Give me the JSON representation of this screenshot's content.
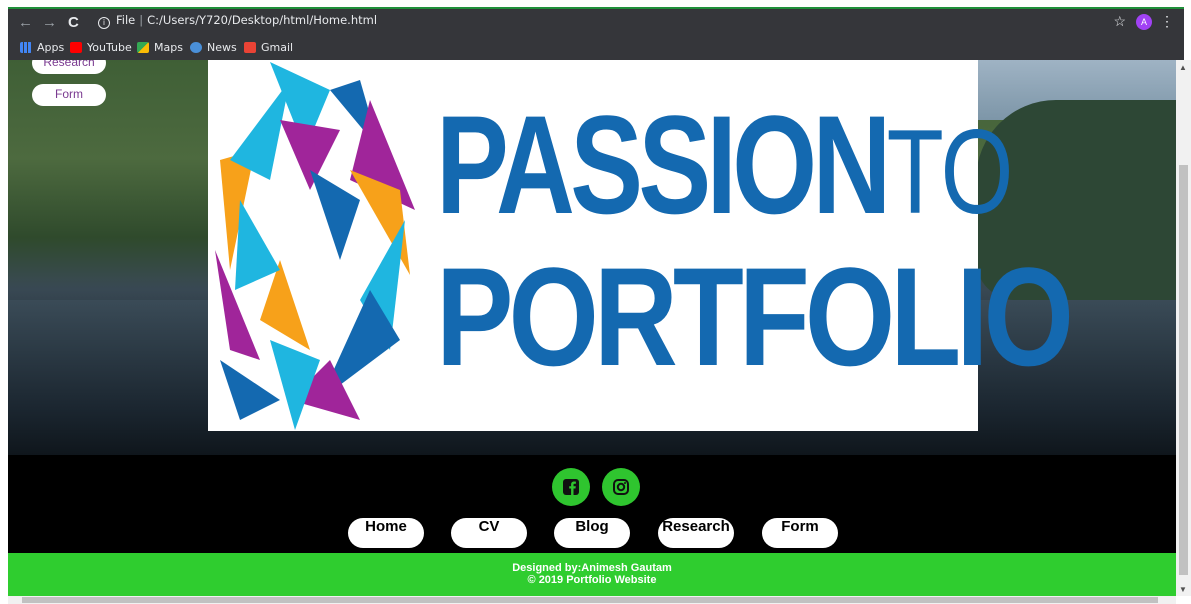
{
  "browser": {
    "url_prefix": "File",
    "url": "C:/Users/Y720/Desktop/html/Home.html",
    "profile_initial": "A",
    "bookmarks": [
      {
        "label": "Apps",
        "color": "#4285f4"
      },
      {
        "label": "YouTube",
        "color": "#ff0000"
      },
      {
        "label": "Maps",
        "color": "#34a853"
      },
      {
        "label": "News",
        "color": "#4a90d9"
      },
      {
        "label": "Gmail",
        "color": "#ea4335"
      }
    ]
  },
  "side_menu": {
    "research_label": "Research",
    "form_label": "Form"
  },
  "logo": {
    "line1_main": "PASSION",
    "line1_small": "TO",
    "line2": "PORTFOLIO",
    "colors": {
      "blue": "#1469b0",
      "cyan": "#1fb6e0",
      "orange": "#f7a11a",
      "purple": "#a0259a"
    }
  },
  "footer": {
    "social": [
      {
        "icon": "facebook-icon"
      },
      {
        "icon": "instagram-icon"
      }
    ],
    "nav": [
      "Home",
      "CV",
      "Blog",
      "Research",
      "Form"
    ],
    "designed_by": "Designed by:Animesh Gautam",
    "copyright": "© 2019 Portfolio Website"
  },
  "colors": {
    "accent_green": "#2fcd2f",
    "footer_bg": "#000000"
  }
}
